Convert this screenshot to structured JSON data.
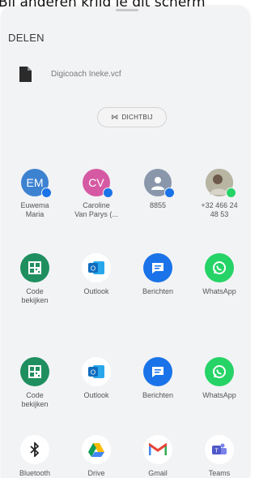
{
  "caption": "Bij anderen krijg je dit scherm",
  "sheet": {
    "title": "DELEN",
    "file_name": "Digicoach Ineke.vcf",
    "close_label": "DICHTBIJ",
    "contacts": [
      {
        "initials": "EM",
        "line1": "Euwema",
        "line2": "Maria",
        "color": "#3d82d1"
      },
      {
        "initials": "CV",
        "line1": "Caroline",
        "line2": "Van Parys (...",
        "color": "#d55aa3"
      },
      {
        "initials": "",
        "line1": "8855",
        "line2": "",
        "color": "#8a97ab"
      },
      {
        "initials": "",
        "line1": "+32 466 24",
        "line2": "48 53",
        "color": "#8b8f74"
      }
    ],
    "apps_row1": [
      {
        "line1": "Code",
        "line2": "bekijken",
        "icon": "qr-code-icon"
      },
      {
        "line1": "Outlook",
        "line2": "",
        "icon": "outlook-icon"
      },
      {
        "line1": "Berichten",
        "line2": "",
        "icon": "messages-icon"
      },
      {
        "line1": "WhatsApp",
        "line2": "",
        "icon": "whatsapp-icon"
      }
    ],
    "apps_row2": [
      {
        "line1": "Code",
        "line2": "bekijken",
        "icon": "qr-code-icon"
      },
      {
        "line1": "Outlook",
        "line2": "",
        "icon": "outlook-icon"
      },
      {
        "line1": "Berichten",
        "line2": "",
        "icon": "messages-icon"
      },
      {
        "line1": "WhatsApp",
        "line2": "",
        "icon": "whatsapp-icon"
      }
    ],
    "apps_row3": [
      {
        "line1": "Bluetooth",
        "icon": "bluetooth-icon"
      },
      {
        "line1": "Drive",
        "icon": "drive-icon"
      },
      {
        "line1": "Gmail",
        "icon": "gmail-icon"
      },
      {
        "line1": "Teams",
        "icon": "teams-icon"
      }
    ]
  },
  "colors": {
    "whatsapp": "#25d366",
    "messages": "#1a73e8",
    "outlook": "#0f6cbd",
    "sheet_bg": "#f2f3f5"
  }
}
